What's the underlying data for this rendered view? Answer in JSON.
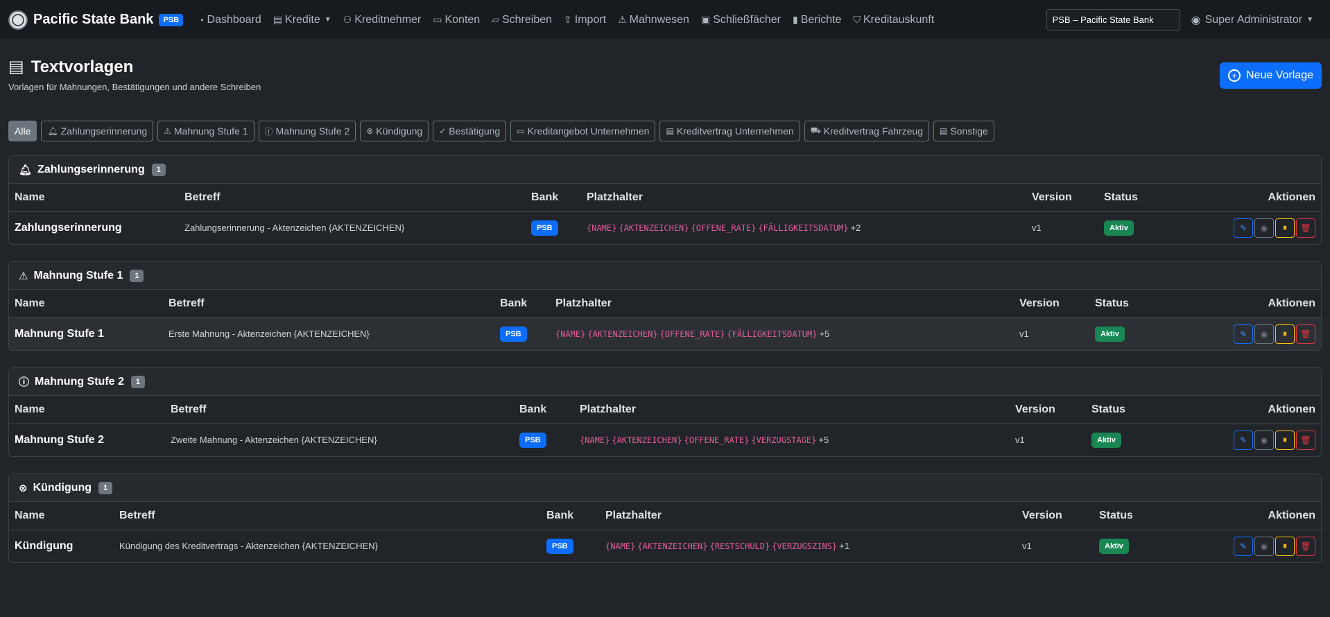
{
  "brand": {
    "name": "Pacific State Bank",
    "badge": "PSB"
  },
  "nav": [
    {
      "label": "Dashboard",
      "icon": "dashboard-icon"
    },
    {
      "label": "Kredite",
      "icon": "document-icon"
    },
    {
      "label": "Kreditnehmer",
      "icon": "people-icon"
    },
    {
      "label": "Konten",
      "icon": "wallet-icon"
    },
    {
      "label": "Schreiben",
      "icon": "folder-icon"
    },
    {
      "label": "Import",
      "icon": "upload-icon"
    },
    {
      "label": "Mahnwesen",
      "icon": "warning-icon"
    },
    {
      "label": "Schließfächer",
      "icon": "safe-icon"
    },
    {
      "label": "Berichte",
      "icon": "bar-chart-icon"
    },
    {
      "label": "Kreditauskunft",
      "icon": "shield-icon"
    }
  ],
  "bank_select": {
    "value": "PSB – Pacific State Bank"
  },
  "user": {
    "name": "Super Administrator"
  },
  "page": {
    "title": "Textvorlagen",
    "subtitle": "Vorlagen für Mahnungen, Bestätigungen und andere Schreiben",
    "new_button": "Neue Vorlage"
  },
  "filters": [
    {
      "label": "Alle",
      "icon": ""
    },
    {
      "label": "Zahlungserinnerung",
      "icon": "bell-icon"
    },
    {
      "label": "Mahnung Stufe 1",
      "icon": "warning-icon"
    },
    {
      "label": "Mahnung Stufe 2",
      "icon": "exclamation-circle-icon"
    },
    {
      "label": "Kündigung",
      "icon": "x-circle-icon"
    },
    {
      "label": "Bestätigung",
      "icon": "check-circle-icon"
    },
    {
      "label": "Kreditangebot Unternehmen",
      "icon": "briefcase-icon"
    },
    {
      "label": "Kreditvertrag Unternehmen",
      "icon": "document-icon"
    },
    {
      "label": "Kreditvertrag Fahrzeug",
      "icon": "car-icon"
    },
    {
      "label": "Sonstige",
      "icon": "document-icon"
    }
  ],
  "columns": {
    "name": "Name",
    "subject": "Betreff",
    "bank": "Bank",
    "placeholders": "Platzhalter",
    "version": "Version",
    "status": "Status",
    "actions": "Aktionen"
  },
  "sections": [
    {
      "title": "Zahlungserinnerung",
      "count": "1",
      "icon": "bell-icon",
      "row": {
        "name": "Zahlungserinnerung",
        "subject": "Zahlungserinnerung - Aktenzeichen {AKTENZEICHEN}",
        "bank": "PSB",
        "placeholders": [
          "{NAME}",
          "{AKTENZEICHEN}",
          "{OFFENE_RATE}",
          "{FÄLLIGKEITSDATUM}"
        ],
        "more": "+2",
        "version": "v1",
        "status": "Aktiv"
      }
    },
    {
      "title": "Mahnung Stufe 1",
      "count": "1",
      "icon": "warning-icon",
      "row": {
        "name": "Mahnung Stufe 1",
        "subject": "Erste Mahnung - Aktenzeichen {AKTENZEICHEN}",
        "bank": "PSB",
        "placeholders": [
          "{NAME}",
          "{AKTENZEICHEN}",
          "{OFFENE_RATE}",
          "{FÄLLIGKEITSDATUM}"
        ],
        "more": "+5",
        "version": "v1",
        "status": "Aktiv"
      }
    },
    {
      "title": "Mahnung Stufe 2",
      "count": "1",
      "icon": "exclamation-circle-icon",
      "row": {
        "name": "Mahnung Stufe 2",
        "subject": "Zweite Mahnung - Aktenzeichen {AKTENZEICHEN}",
        "bank": "PSB",
        "placeholders": [
          "{NAME}",
          "{AKTENZEICHEN}",
          "{OFFENE_RATE}",
          "{VERZUGSTAGE}"
        ],
        "more": "+5",
        "version": "v1",
        "status": "Aktiv"
      }
    },
    {
      "title": "Kündigung",
      "count": "1",
      "icon": "x-circle-icon",
      "row": {
        "name": "Kündigung",
        "subject": "Kündigung des Kreditvertrags - Aktenzeichen {AKTENZEICHEN}",
        "bank": "PSB",
        "placeholders": [
          "{NAME}",
          "{AKTENZEICHEN}",
          "{RESTSCHULD}",
          "{VERZUGSZINS}"
        ],
        "more": "+1",
        "version": "v1",
        "status": "Aktiv"
      }
    }
  ]
}
